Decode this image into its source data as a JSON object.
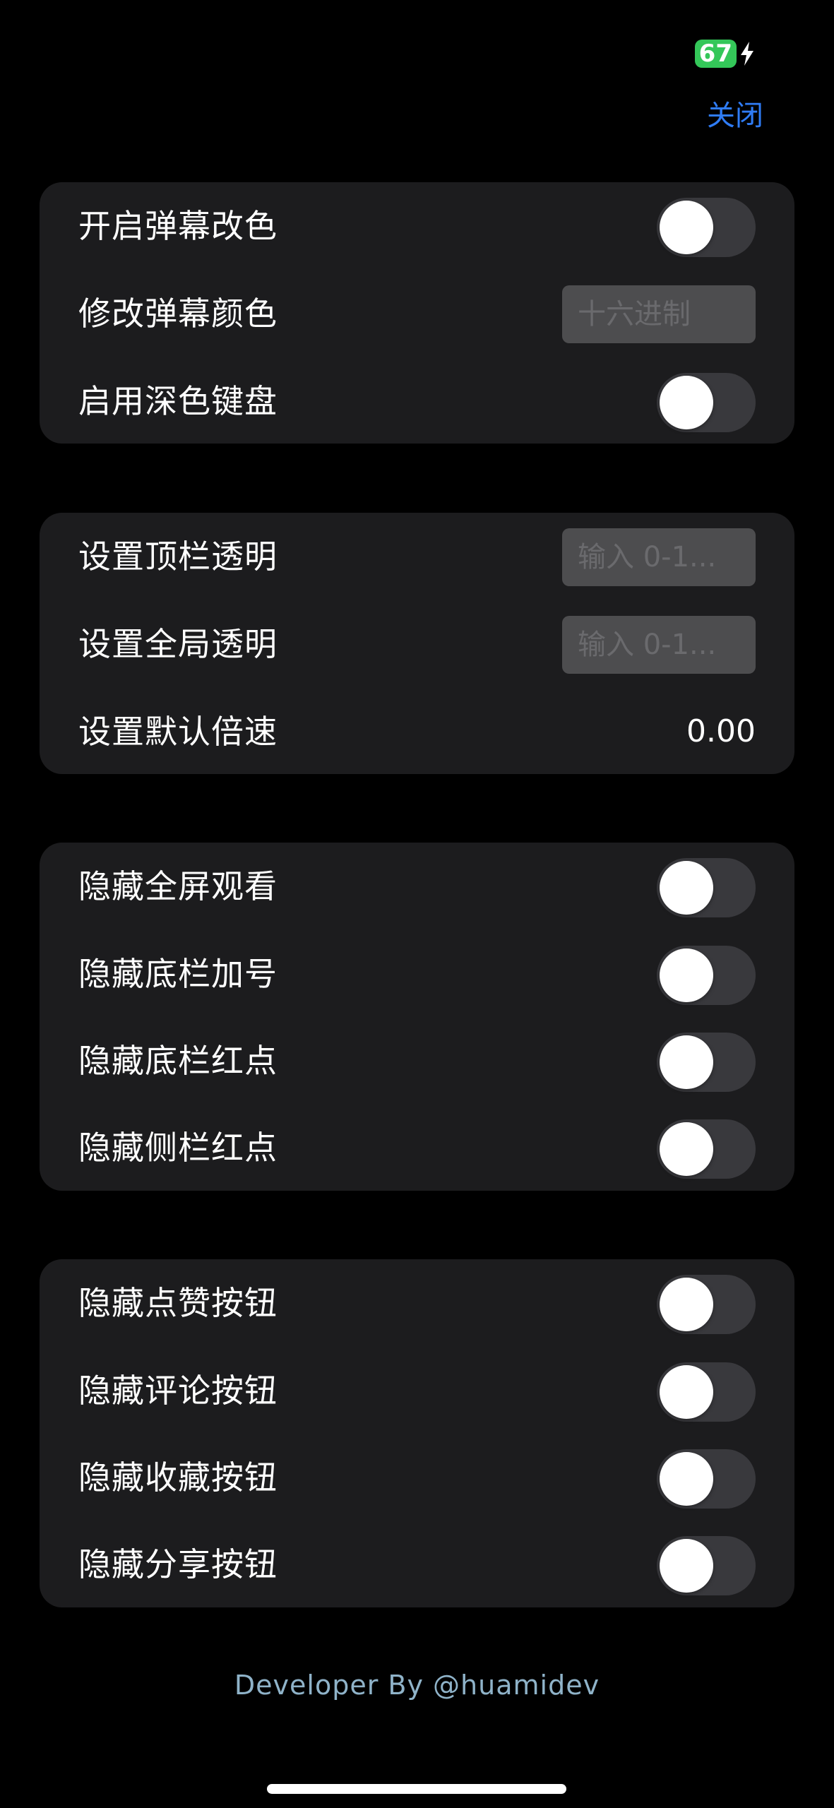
{
  "status_bar": {
    "battery": "67"
  },
  "header": {
    "close_label": "关闭"
  },
  "groups": [
    {
      "rows": [
        {
          "label": "开启弹幕改色",
          "control": "toggle",
          "on": false
        },
        {
          "label": "修改弹幕颜色",
          "control": "input",
          "placeholder": "十六进制"
        },
        {
          "label": "启用深色键盘",
          "control": "toggle",
          "on": false
        }
      ]
    },
    {
      "rows": [
        {
          "label": "设置顶栏透明",
          "control": "input",
          "placeholder": "输入 0-1..."
        },
        {
          "label": "设置全局透明",
          "control": "input",
          "placeholder": "输入 0-1..."
        },
        {
          "label": "设置默认倍速",
          "control": "value",
          "value": "0.00"
        }
      ]
    },
    {
      "rows": [
        {
          "label": "隐藏全屏观看",
          "control": "toggle",
          "on": false
        },
        {
          "label": "隐藏底栏加号",
          "control": "toggle",
          "on": false
        },
        {
          "label": "隐藏底栏红点",
          "control": "toggle",
          "on": false
        },
        {
          "label": "隐藏侧栏红点",
          "control": "toggle",
          "on": false
        }
      ]
    },
    {
      "rows": [
        {
          "label": "隐藏点赞按钮",
          "control": "toggle",
          "on": false
        },
        {
          "label": "隐藏评论按钮",
          "control": "toggle",
          "on": false
        },
        {
          "label": "隐藏收藏按钮",
          "control": "toggle",
          "on": false
        },
        {
          "label": "隐藏分享按钮",
          "control": "toggle",
          "on": false
        }
      ]
    }
  ],
  "footer": {
    "credit": "Developer By @huamidev"
  },
  "colors": {
    "accent": "#2f7cf6",
    "battery": "#34c759",
    "group_background": "#1c1c1e",
    "toggle_off": "#39393d",
    "footer_text": "#8fb3c9"
  },
  "icons": {
    "battery": "battery-icon",
    "charging": "charging-bolt-icon"
  }
}
